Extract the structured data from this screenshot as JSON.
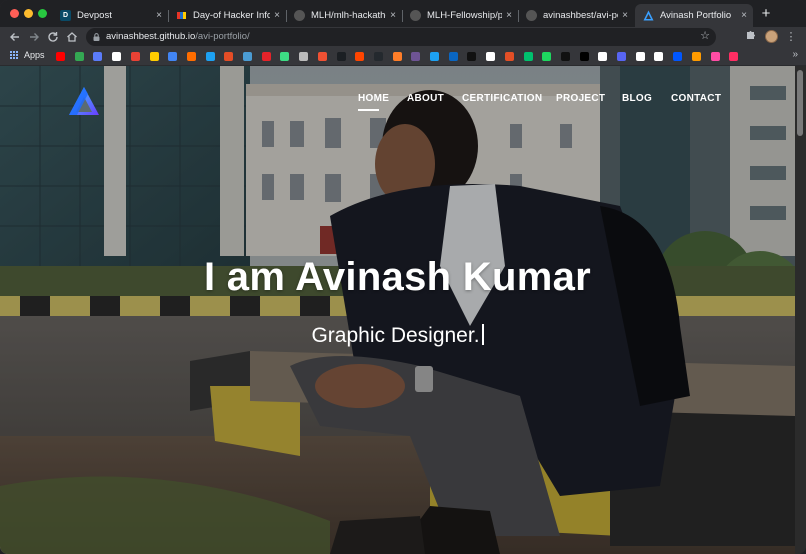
{
  "browser": {
    "tabs": [
      {
        "title": "Devpost",
        "favicon_letter": "D",
        "favicon_color": "#003e54",
        "active": false
      },
      {
        "title": "Day-of Hacker Info",
        "favicon_letter": "",
        "favicon_color": "#e73427",
        "active": false
      },
      {
        "title": "MLH/mlh-hackatho",
        "favicon_letter": "",
        "favicon_color": "#3c3c3c",
        "active": false
      },
      {
        "title": "MLH-Fellowship/po",
        "favicon_letter": "",
        "favicon_color": "#3c3c3c",
        "active": false
      },
      {
        "title": "avinashbest/avi-po",
        "favicon_letter": "",
        "favicon_color": "#3c3c3c",
        "active": false
      },
      {
        "title": "Avinash Portfolio",
        "favicon_letter": "",
        "favicon_color": "#2f8cff",
        "active": true
      }
    ],
    "close_glyph": "×",
    "new_tab_glyph": "+",
    "url_host": "avinashbest.github.io",
    "url_path": "/avi-portfolio/",
    "bookmarks_apps_label": "Apps",
    "bookmark_colors": [
      "#ff0000",
      "#34a853",
      "#5b7cfa",
      "#ffffff",
      "#e94235",
      "#ffcc00",
      "#4285f4",
      "#ff6d00",
      "#1da1f2",
      "#e44d26",
      "#4b9cd3",
      "#e6232a",
      "#3ddc84",
      "#bbbbbb",
      "#f05133",
      "#1b1f23",
      "#ff4500",
      "#24292e",
      "#ff7e29",
      "#6e5494",
      "#1da1f2",
      "#0a66c2",
      "#111111",
      "#ffffff",
      "#e34f26",
      "#00c16e",
      "#1ed760",
      "#111111",
      "#000000",
      "#ffffff",
      "#5865f2",
      "#ffffff",
      "#ffffff",
      "#0057ff",
      "#ff9b00",
      "#ff4da6",
      "#ff2e63"
    ]
  },
  "site": {
    "nav": [
      {
        "label": "HOME",
        "active": true
      },
      {
        "label": "ABOUT",
        "active": false
      },
      {
        "label": "CERTIFICATION",
        "active": false
      },
      {
        "label": "PROJECT",
        "active": false
      },
      {
        "label": "BLOG",
        "active": false
      },
      {
        "label": "CONTACT",
        "active": false
      }
    ],
    "hero_title": "I am Avinash Kumar",
    "hero_subtitle": "Graphic Designer.",
    "logo_colors": [
      "#1e6bff",
      "#3ad0ff",
      "#6a3dff"
    ]
  }
}
